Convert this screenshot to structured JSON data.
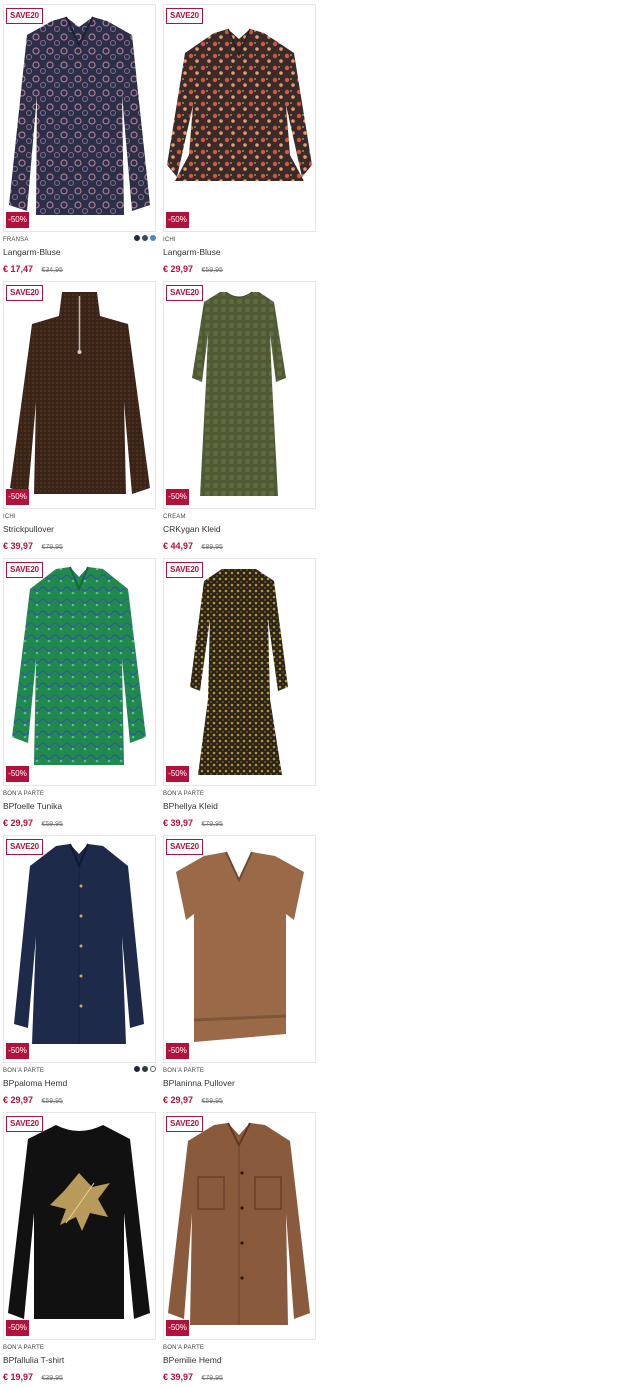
{
  "colors": {
    "accent": "#b0123c",
    "price_now": "#b0123c",
    "price_old": "#777777",
    "card_border": "#e6e6e6"
  },
  "products": [
    {
      "brand": "FRANSA",
      "name": "Langarm-Bluse",
      "price_now": "€ 17,47",
      "price_old": "€34,95",
      "badge_save": "SAVE20",
      "badge_discount": "-50%",
      "garment_icon": "blouse-icon",
      "swatches": [
        "#1f2a44",
        "#3b4a5a",
        "#4a86c5"
      ]
    },
    {
      "brand": "ICHI",
      "name": "Langarm-Bluse",
      "price_now": "€ 29,97",
      "price_old": "€59,95",
      "badge_save": "SAVE20",
      "badge_discount": "-50%",
      "garment_icon": "blouse-icon",
      "swatches": []
    },
    {
      "brand": "ICHI",
      "name": "Strickpullover",
      "price_now": "€ 39,97",
      "price_old": "€79,95",
      "badge_save": "SAVE20",
      "badge_discount": "-50%",
      "garment_icon": "pullover-icon",
      "swatches": []
    },
    {
      "brand": "CREAM",
      "name": "CRKygan Kleid",
      "price_now": "€ 44,97",
      "price_old": "€89,95",
      "badge_save": "SAVE20",
      "badge_discount": "-50%",
      "garment_icon": "dress-icon",
      "swatches": []
    },
    {
      "brand": "BON'A PARTE",
      "name": "BPfoelle Tunika",
      "price_now": "€ 29,97",
      "price_old": "€59,95",
      "badge_save": "SAVE20",
      "badge_discount": "-50%",
      "garment_icon": "shirt-icon",
      "swatches": []
    },
    {
      "brand": "BON'A PARTE",
      "name": "BPhellya Kleid",
      "price_now": "€ 39,97",
      "price_old": "€79,95",
      "badge_save": "SAVE20",
      "badge_discount": "-50%",
      "garment_icon": "dress-icon",
      "swatches": []
    },
    {
      "brand": "BON'A PARTE",
      "name": "BPpaloma Hemd",
      "price_now": "€ 29,97",
      "price_old": "€59,95",
      "badge_save": "SAVE20",
      "badge_discount": "-50%",
      "garment_icon": "shirt-icon",
      "swatches": [
        "#1d2640",
        "#2f3a3a",
        "#ffffff"
      ]
    },
    {
      "brand": "BON'A PARTE",
      "name": "BPlaninna Pullover",
      "price_now": "€ 29,97",
      "price_old": "€59,95",
      "badge_save": "SAVE20",
      "badge_discount": "-50%",
      "garment_icon": "vest-icon",
      "swatches": []
    },
    {
      "brand": "BON'A PARTE",
      "name": "BPfallulia T-shirt",
      "price_now": "€ 19,97",
      "price_old": "€39,95",
      "badge_save": "SAVE20",
      "badge_discount": "-50%",
      "garment_icon": "tshirt-icon",
      "swatches": []
    },
    {
      "brand": "BON'A PARTE",
      "name": "BPemilie Hemd",
      "price_now": "€ 39,97",
      "price_old": "€79,95",
      "badge_save": "SAVE20",
      "badge_discount": "-50%",
      "garment_icon": "shirt-jacket-icon",
      "swatches": []
    }
  ]
}
